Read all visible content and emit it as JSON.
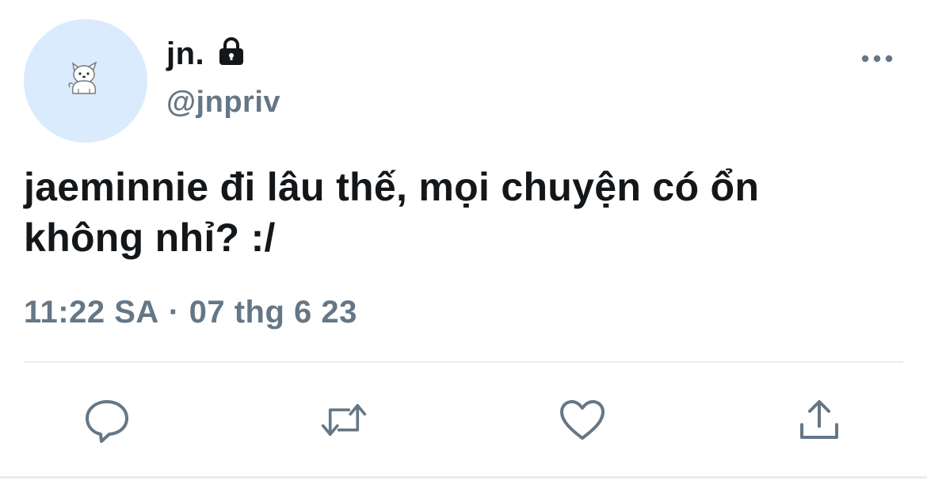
{
  "author": {
    "display_name": "jn.",
    "handle": "@jnpriv",
    "protected_icon": "lock-icon",
    "avatar_icon": "dog-icon",
    "avatar_bg": "#d9ebfd"
  },
  "tweet": {
    "text_line1": "jaeminnie đi lâu thế, mọi chuyện có ổn",
    "text_line2": "không nhỉ? :/",
    "time": "11:22 SA",
    "separator": "·",
    "date": "07 thg 6 23"
  },
  "actions": {
    "more_icon": "more-horizontal-icon",
    "reply_icon": "reply-icon",
    "retweet_icon": "retweet-icon",
    "like_icon": "heart-icon",
    "share_icon": "share-icon"
  },
  "colors": {
    "text": "#14171a",
    "secondary": "#657786",
    "divider": "#e6ecf0"
  }
}
